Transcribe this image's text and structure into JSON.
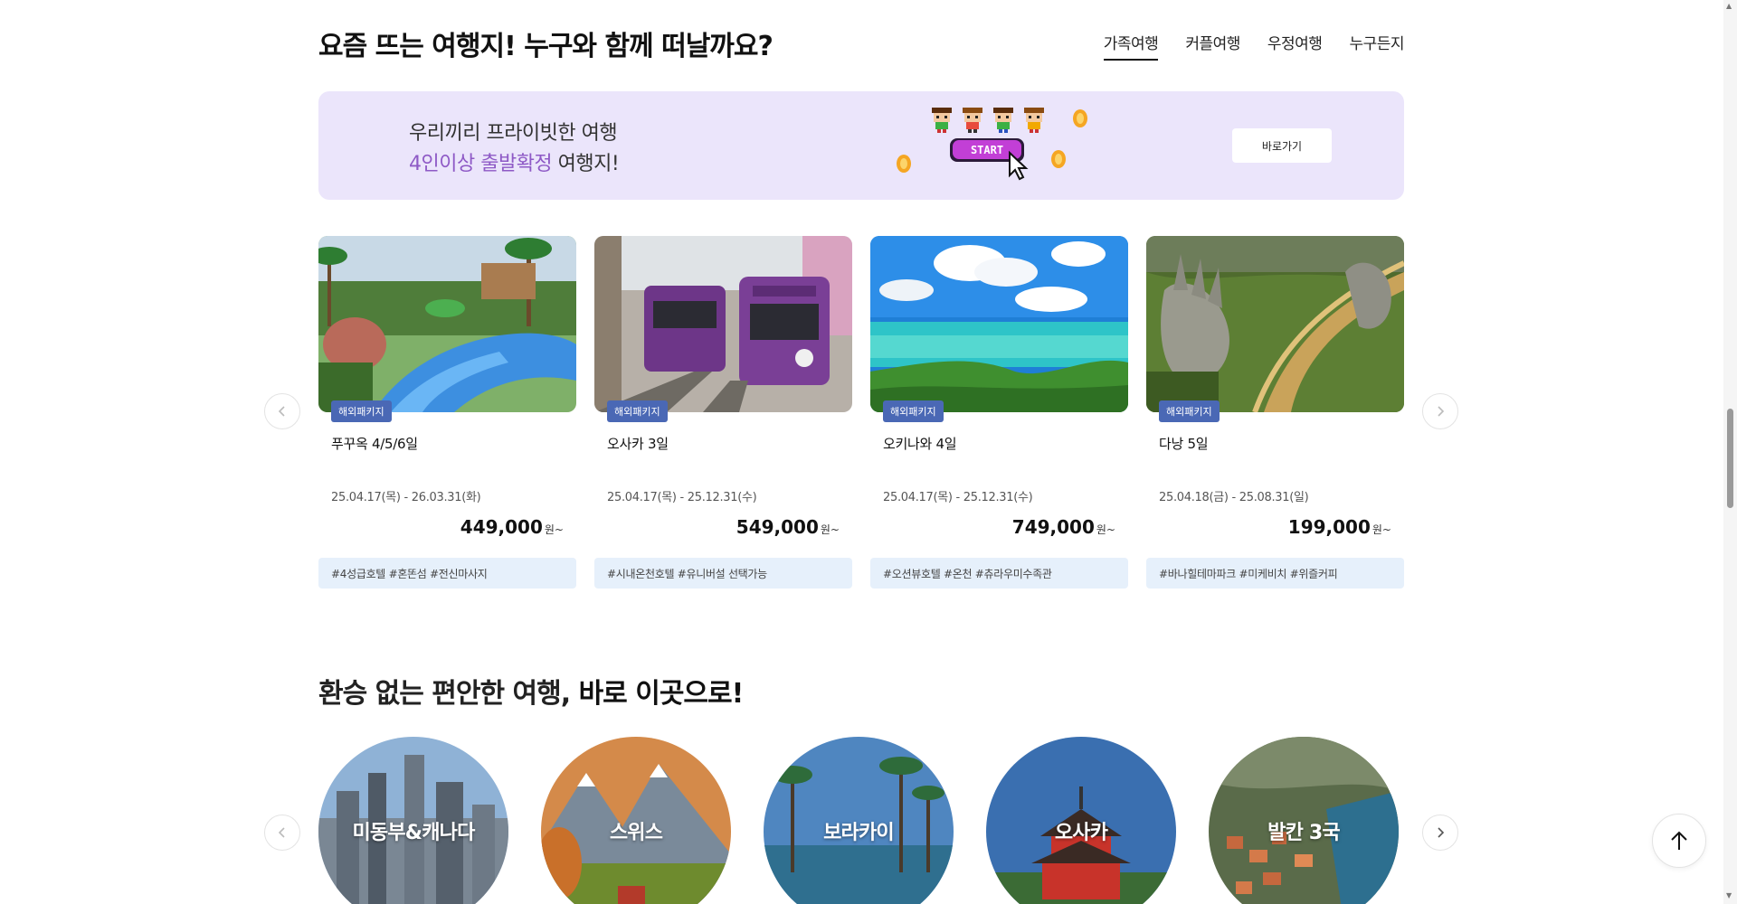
{
  "section1": {
    "title": "요즘 뜨는 여행지! 누구와 함께 떠날까요?",
    "tabs": [
      {
        "label": "가족여행",
        "active": true
      },
      {
        "label": "커플여행",
        "active": false
      },
      {
        "label": "우정여행",
        "active": false
      },
      {
        "label": "누구든지",
        "active": false
      }
    ]
  },
  "banner": {
    "line1": "우리끼리 프라이빗한 여행",
    "line2_highlight": "4인이상 출발확정",
    "line2_rest": " 여행지!",
    "start_text": "START",
    "button_label": "바로가기",
    "bg_color": "#ebe5fb",
    "highlight_color": "#8e59c6"
  },
  "products": [
    {
      "badge": "해외패키지",
      "title": "푸꾸옥 4/5/6일",
      "dates": "25.04.17(목) - 26.03.31(화)",
      "price": "449,000",
      "currency": "원~",
      "tags": "#4성급호텔 #혼똔섬 #전신마사지",
      "scene": "waterpark"
    },
    {
      "badge": "해외패키지",
      "title": "오사카 3일",
      "dates": "25.04.17(목) - 25.12.31(수)",
      "price": "549,000",
      "currency": "원~",
      "tags": "#시내온천호텔 #유니버설 선택가능",
      "scene": "train"
    },
    {
      "badge": "해외패키지",
      "title": "오키나와 4일",
      "dates": "25.04.17(목) - 25.12.31(수)",
      "price": "749,000",
      "currency": "원~",
      "tags": "#오션뷰호텔 #온천 #츄라우미수족관",
      "scene": "sea"
    },
    {
      "badge": "해외패키지",
      "title": "다낭 5일",
      "dates": "25.04.18(금) - 25.08.31(일)",
      "price": "199,000",
      "currency": "원~",
      "tags": "#바나힐테마파크 #미케비치 #위즐커피",
      "scene": "golden-bridge"
    }
  ],
  "section2": {
    "title_regular": "환승 없는 편안한 여행, ",
    "title_bold": "바로 이곳으로!"
  },
  "destinations": [
    {
      "label": "미동부&캐나다",
      "scene": "city"
    },
    {
      "label": "스위스",
      "scene": "alps"
    },
    {
      "label": "보라카이",
      "scene": "palm"
    },
    {
      "label": "오사카",
      "scene": "pagoda"
    },
    {
      "label": "발칸 3국",
      "scene": "coast"
    }
  ],
  "icons": {
    "prev": "chevron-left-icon",
    "next": "chevron-right-icon",
    "top": "arrow-up-icon"
  }
}
